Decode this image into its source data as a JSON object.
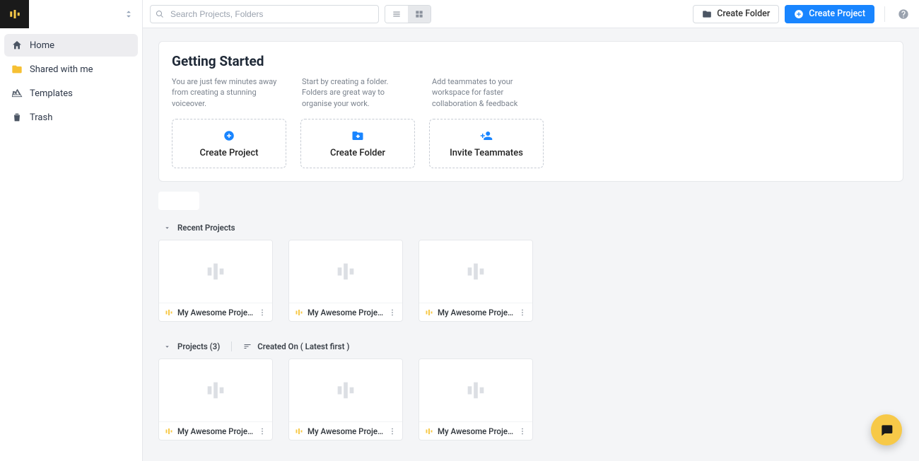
{
  "search": {
    "placeholder": "Search Projects, Folders"
  },
  "header": {
    "create_folder": "Create Folder",
    "create_project": "Create Project"
  },
  "sidebar": {
    "home": "Home",
    "shared": "Shared with me",
    "templates": "Templates",
    "trash": "Trash"
  },
  "getting_started": {
    "title": "Getting Started",
    "desc1": "You are just few minutes away from creating a stunning voiceover.",
    "desc2": "Start by creating a folder. Folders are great way to organise your work.",
    "desc3": "Add teammates to your workspace for faster collaboration & feedback",
    "card1": "Create Project",
    "card2": "Create Folder",
    "card3": "Invite Teammates"
  },
  "sections": {
    "recent": "Recent Projects",
    "projects": "Projects (3)",
    "sort": "Created On ( Latest first )"
  },
  "projects": {
    "recent": [
      {
        "name": "My Awesome Project"
      },
      {
        "name": "My Awesome Project"
      },
      {
        "name": "My Awesome Project"
      }
    ],
    "all": [
      {
        "name": "My Awesome Project"
      },
      {
        "name": "My Awesome Project"
      },
      {
        "name": "My Awesome Project"
      }
    ]
  }
}
